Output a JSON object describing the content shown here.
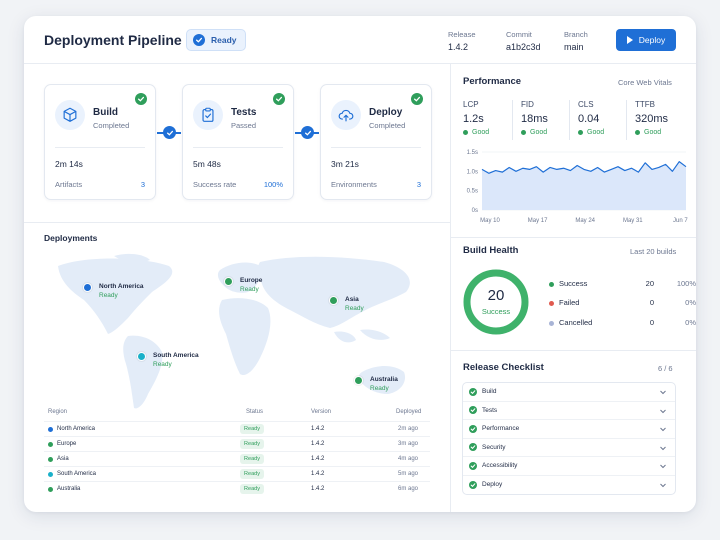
{
  "header": {
    "title": "Deployment Pipeline",
    "status": "Ready",
    "meta": [
      {
        "label": "Release",
        "value": "1.4.2"
      },
      {
        "label": "Commit",
        "value": "a1b2c3d"
      },
      {
        "label": "Branch",
        "value": "main"
      }
    ],
    "deploy_label": "Deploy"
  },
  "stages": [
    {
      "name": "Build",
      "status": "Completed",
      "duration": "2m 14s",
      "key": "Artifacts",
      "value": "3"
    },
    {
      "name": "Tests",
      "status": "Passed",
      "duration": "5m 48s",
      "key": "Success rate",
      "value": "100%"
    },
    {
      "name": "Deploy",
      "status": "Completed",
      "duration": "3m 21s",
      "key": "Environments",
      "value": "3"
    }
  ],
  "performance": {
    "title": "Performance",
    "aside": "Core Web Vitals",
    "metrics": [
      {
        "key": "LCP",
        "value": "1.2s",
        "rating": "Good"
      },
      {
        "key": "FID",
        "value": "18ms",
        "rating": "Good"
      },
      {
        "key": "CLS",
        "value": "0.04",
        "rating": "Good"
      },
      {
        "key": "TTFB",
        "value": "320ms",
        "rating": "Good"
      }
    ]
  },
  "chart_data": {
    "type": "area",
    "x": [
      "May 10",
      "",
      "",
      "",
      "",
      "",
      "",
      "May 17",
      "",
      "",
      "",
      "",
      "",
      "",
      "May 24",
      "",
      "",
      "",
      "",
      "",
      "",
      "May 31",
      "",
      "",
      "",
      "",
      "",
      "",
      "Jun 7",
      ""
    ],
    "y_ticks": [
      "1.5s",
      "1.0s",
      "0.5s",
      "0s"
    ],
    "ylim": [
      0,
      1.5
    ],
    "x_ticks": [
      "May 10",
      "May 17",
      "May 24",
      "May 31",
      "Jun 7"
    ],
    "values": [
      1.05,
      0.95,
      1.02,
      0.98,
      1.1,
      1.0,
      1.08,
      1.05,
      1.12,
      0.98,
      1.1,
      1.05,
      1.08,
      1.02,
      1.15,
      1.05,
      1.0,
      1.1,
      0.98,
      1.05,
      1.12,
      1.02,
      1.08,
      0.98,
      1.22,
      1.05,
      1.1,
      1.18,
      1.0,
      1.25,
      1.12
    ],
    "title": "",
    "xlabel": "",
    "ylabel": ""
  },
  "build_health": {
    "title": "Build Health",
    "aside": "Last 20 builds",
    "total": "20",
    "total_label": "Success",
    "rows": [
      {
        "label": "Success",
        "count": "20",
        "pct": "100%",
        "color": "#2f9e5b"
      },
      {
        "label": "Failed",
        "count": "0",
        "pct": "0%",
        "color": "#e05a4f"
      },
      {
        "label": "Cancelled",
        "count": "0",
        "pct": "0%",
        "color": "#a8b4d6"
      }
    ],
    "success_fraction": 1.0
  },
  "checklist": {
    "title": "Release Checklist",
    "count": "6 / 6",
    "items": [
      "Build",
      "Tests",
      "Performance",
      "Security",
      "Accessibility",
      "Deploy"
    ]
  },
  "deployments": {
    "title": "Deployments",
    "regions": [
      {
        "name": "North America",
        "status": "Ready",
        "color": "#1f6fd6"
      },
      {
        "name": "Europe",
        "status": "Ready",
        "color": "#2f9e5b"
      },
      {
        "name": "Asia",
        "status": "Ready",
        "color": "#2f9e5b"
      },
      {
        "name": "South America",
        "status": "Ready",
        "color": "#1ab0c9"
      },
      {
        "name": "Australia",
        "status": "Ready",
        "color": "#2f9e5b"
      }
    ],
    "columns": [
      "Region",
      "Status",
      "Version",
      "Deployed"
    ],
    "rows": [
      {
        "region": "North America",
        "status": "Ready",
        "version": "1.4.2",
        "deployed": "2m ago",
        "color": "#1f6fd6"
      },
      {
        "region": "Europe",
        "status": "Ready",
        "version": "1.4.2",
        "deployed": "3m ago",
        "color": "#2f9e5b"
      },
      {
        "region": "Asia",
        "status": "Ready",
        "version": "1.4.2",
        "deployed": "4m ago",
        "color": "#2f9e5b"
      },
      {
        "region": "South America",
        "status": "Ready",
        "version": "1.4.2",
        "deployed": "5m ago",
        "color": "#1ab0c9"
      },
      {
        "region": "Australia",
        "status": "Ready",
        "version": "1.4.2",
        "deployed": "6m ago",
        "color": "#2f9e5b"
      }
    ]
  }
}
